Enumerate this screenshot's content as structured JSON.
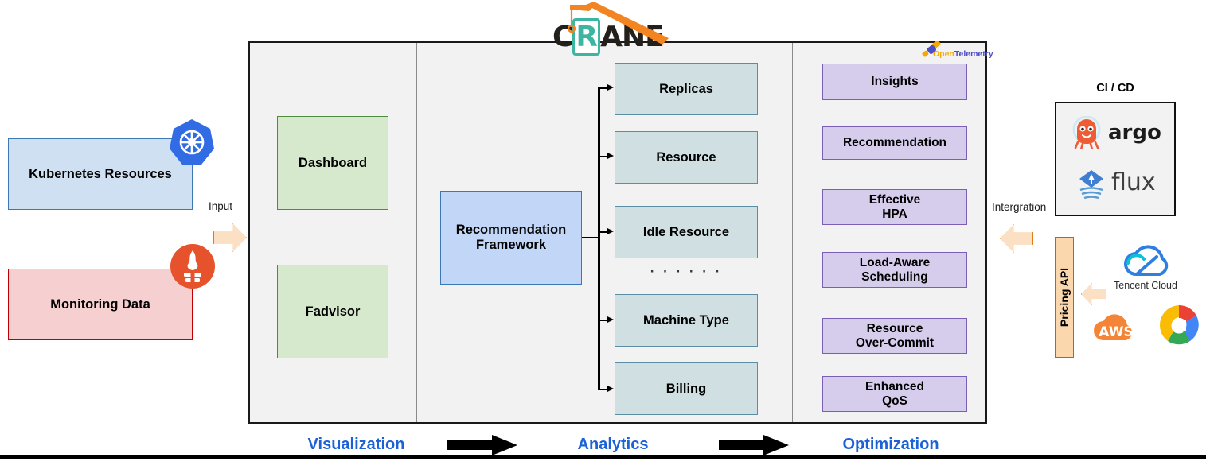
{
  "diagram": {
    "title": "CRANE",
    "logo": {
      "text_before": "C",
      "boxed_letter": "R",
      "text_after": "ANE"
    },
    "bottom_stages": [
      {
        "label": "Visualization"
      },
      {
        "label": "Analytics"
      },
      {
        "label": "Optimization"
      }
    ]
  },
  "inputs": {
    "kubernetes": {
      "label": "Kubernetes Resources",
      "icon": "kubernetes-icon",
      "fill": "#cfe0f3",
      "stroke": "#3c78b4"
    },
    "monitoring": {
      "label": "Monitoring Data",
      "icon": "prometheus-icon",
      "fill": "#f6cfd0",
      "stroke": "#c00000"
    },
    "input_arrow_label": "Input"
  },
  "visualization": {
    "items": [
      {
        "label": "Dashboard"
      },
      {
        "label": "Fadvisor"
      }
    ],
    "fill": "#d7e9cd",
    "stroke": "#4f8a3d"
  },
  "analytics": {
    "framework": {
      "line1": "Recommendation",
      "line2": "Framework",
      "fill": "#c2d7f7",
      "stroke": "#3c78b4"
    },
    "outputs": [
      {
        "label": "Replicas"
      },
      {
        "label": "Resource"
      },
      {
        "label": "Idle Resource"
      },
      {
        "label": "Machine Type"
      },
      {
        "label": "Billing"
      }
    ],
    "ellipsis": "· · · · · ·",
    "fill": "#cfdfe2",
    "stroke": "#5b8ea3"
  },
  "optimization": {
    "items": [
      {
        "line1": "Insights",
        "line2": ""
      },
      {
        "line1": "Recommendation",
        "line2": ""
      },
      {
        "line1": "Effective",
        "line2": "HPA"
      },
      {
        "line1": "Load-Aware",
        "line2": "Scheduling"
      },
      {
        "line1": "Resource",
        "line2": "Over-Commit"
      },
      {
        "line1": "Enhanced",
        "line2": "QoS"
      }
    ],
    "fill": "#d6cdec",
    "stroke": "#7b5fb5",
    "opentelemetry": {
      "part1": "Open",
      "part2": "Telemetry",
      "color1": "#f5a800",
      "color2": "#4e4ec4"
    }
  },
  "integration": {
    "arrow_label": "Intergration",
    "cicd_title": "CI / CD",
    "cicd_logos": [
      {
        "name": "argo-logo",
        "label": "argo"
      },
      {
        "name": "flux-logo",
        "label": "flux"
      }
    ],
    "pricing_api_label": "Pricing API",
    "cloud_logos": [
      {
        "name": "tencent-cloud-logo",
        "label": "Tencent Cloud"
      },
      {
        "name": "aws-logo",
        "label": "AWS"
      },
      {
        "name": "google-cloud-logo",
        "label": ""
      }
    ]
  },
  "colors": {
    "stage_label": "#1c62d6",
    "panel_bg": "#f2f2f2",
    "panel_border": "#1a1a1a",
    "arrow_orange_fill": "#fbe0c4",
    "arrow_orange_stroke": "#e07b18"
  }
}
